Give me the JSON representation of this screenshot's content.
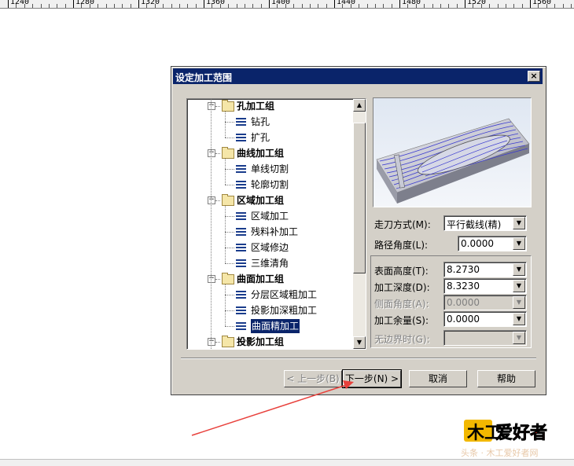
{
  "ruler": {
    "labels": [
      "1240",
      "1280",
      "1320",
      "1360",
      "1400",
      "1440",
      "1480",
      "1520",
      "1560"
    ]
  },
  "dialog": {
    "title": "设定加工范围",
    "close_glyph": "×",
    "tree": [
      {
        "kind": "group",
        "label": "孔加工组"
      },
      {
        "kind": "leaf",
        "label": "钻孔"
      },
      {
        "kind": "leaf",
        "label": "扩孔"
      },
      {
        "kind": "group",
        "label": "曲线加工组"
      },
      {
        "kind": "leaf",
        "label": "单线切割"
      },
      {
        "kind": "leaf",
        "label": "轮廓切割"
      },
      {
        "kind": "group",
        "label": "区域加工组"
      },
      {
        "kind": "leaf",
        "label": "区域加工"
      },
      {
        "kind": "leaf",
        "label": "残料补加工"
      },
      {
        "kind": "leaf",
        "label": "区域修边"
      },
      {
        "kind": "leaf",
        "label": "三维清角"
      },
      {
        "kind": "group",
        "label": "曲面加工组"
      },
      {
        "kind": "leaf",
        "label": "分层区域粗加工"
      },
      {
        "kind": "leaf",
        "label": "投影加深粗加工"
      },
      {
        "kind": "leaf",
        "label": "曲面精加工",
        "selected": true
      },
      {
        "kind": "group",
        "label": "投影加工组"
      }
    ],
    "fields": {
      "tool_path": {
        "label": "走刀方式(M):",
        "value": "平行截线(精)"
      },
      "path_angle": {
        "label": "路径角度(L):",
        "value": "0.0000"
      },
      "surface_height": {
        "label": "表面高度(T):",
        "value": "8.2730"
      },
      "machining_depth": {
        "label": "加工深度(D):",
        "value": "8.3230"
      },
      "side_angle": {
        "label": "侧面角度(A):",
        "value": "0.0000",
        "disabled": true
      },
      "allowance": {
        "label": "加工余量(S):",
        "value": "0.0000"
      },
      "no_boundary": {
        "label": "无边界时(G):",
        "value": "",
        "disabled": true
      }
    },
    "buttons": {
      "back": "< 上一步(B)",
      "next": "下一步(N) >",
      "cancel": "取消",
      "help": "帮助"
    }
  },
  "logo": {
    "text": "爱好者"
  },
  "watermark": "头条 · 木工爱好者网",
  "colors": {
    "title_bar": "#0a246a",
    "face": "#d4d0c8",
    "arrow": "#e8413c",
    "logo_red": "#d4231a"
  }
}
